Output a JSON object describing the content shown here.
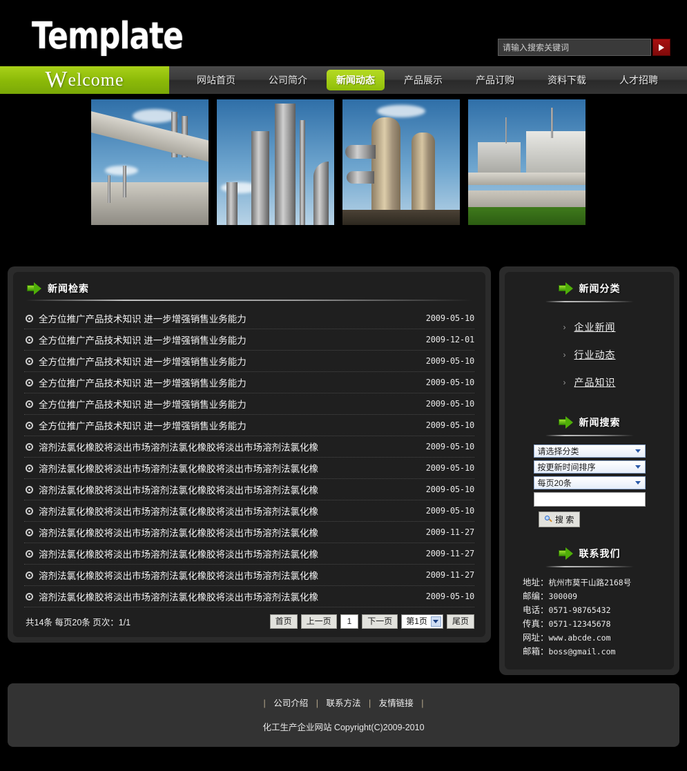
{
  "header": {
    "logo": "Template",
    "search": {
      "placeholder": "请输入搜索关键词",
      "value": "",
      "submit_icon": "play-triangle-icon"
    }
  },
  "nav": {
    "welcome_cap": "W",
    "welcome_rest": "elcome",
    "items": [
      {
        "label": "网站首页",
        "active": false
      },
      {
        "label": "公司简介",
        "active": false
      },
      {
        "label": "新闻动态",
        "active": true
      },
      {
        "label": "产品展示",
        "active": false
      },
      {
        "label": "产品订购",
        "active": false
      },
      {
        "label": "资料下载",
        "active": false
      },
      {
        "label": "人才招聘",
        "active": false
      }
    ]
  },
  "banner": {
    "images": [
      {
        "alt": "水泥厂输送廊道与烟囱"
      },
      {
        "alt": "炼油厂蒸馏塔"
      },
      {
        "alt": "化工厂管道与反应塔"
      },
      {
        "alt": "储油罐区"
      }
    ]
  },
  "news_panel": {
    "title": "新闻检索",
    "icon": "green-arrow-icon",
    "rows": [
      {
        "title": "全方位推广产品技术知识  进一步增强销售业务能力",
        "date": "2009-05-10"
      },
      {
        "title": "全方位推广产品技术知识  进一步增强销售业务能力",
        "date": "2009-12-01"
      },
      {
        "title": "全方位推广产品技术知识  进一步增强销售业务能力",
        "date": "2009-05-10"
      },
      {
        "title": "全方位推广产品技术知识  进一步增强销售业务能力",
        "date": "2009-05-10"
      },
      {
        "title": "全方位推广产品技术知识  进一步增强销售业务能力",
        "date": "2009-05-10"
      },
      {
        "title": "全方位推广产品技术知识  进一步增强销售业务能力",
        "date": "2009-05-10"
      },
      {
        "title": "溶剂法氯化橡胶将淡出市场溶剂法氯化橡胶将淡出市场溶剂法氯化橡",
        "date": "2009-05-10"
      },
      {
        "title": "溶剂法氯化橡胶将淡出市场溶剂法氯化橡胶将淡出市场溶剂法氯化橡",
        "date": "2009-05-10"
      },
      {
        "title": "溶剂法氯化橡胶将淡出市场溶剂法氯化橡胶将淡出市场溶剂法氯化橡",
        "date": "2009-05-10"
      },
      {
        "title": "溶剂法氯化橡胶将淡出市场溶剂法氯化橡胶将淡出市场溶剂法氯化橡",
        "date": "2009-05-10"
      },
      {
        "title": "溶剂法氯化橡胶将淡出市场溶剂法氯化橡胶将淡出市场溶剂法氯化橡",
        "date": "2009-11-27"
      },
      {
        "title": "溶剂法氯化橡胶将淡出市场溶剂法氯化橡胶将淡出市场溶剂法氯化橡",
        "date": "2009-11-27"
      },
      {
        "title": "溶剂法氯化橡胶将淡出市场溶剂法氯化橡胶将淡出市场溶剂法氯化橡",
        "date": "2009-11-27"
      },
      {
        "title": "溶剂法氯化橡胶将淡出市场溶剂法氯化橡胶将淡出市场溶剂法氯化橡",
        "date": "2009-05-10"
      }
    ],
    "pager": {
      "info": "共14条 每页20条 页次：1/1",
      "first": "首页",
      "prev": "上一页",
      "current": "1",
      "next": "下一页",
      "jump_value": "第1页",
      "last": "尾页"
    }
  },
  "sidebar": {
    "category": {
      "title": "新闻分类",
      "icon": "green-arrow-icon",
      "items": [
        {
          "chevron": "›",
          "label": "企业新闻"
        },
        {
          "chevron": "›",
          "label": "行业动态"
        },
        {
          "chevron": "›",
          "label": "产品知识"
        }
      ]
    },
    "search": {
      "title": "新闻搜索",
      "icon": "green-arrow-icon",
      "category_select": "请选择分类",
      "sort_select": "按更新时间排序",
      "pagesize_select": "每页20条",
      "keyword_value": "",
      "keyword_placeholder": "",
      "button_label": "搜 索",
      "button_icon": "magnifier-icon"
    },
    "contact": {
      "title": "联系我们",
      "icon": "green-arrow-icon",
      "rows": [
        {
          "label": "地址：",
          "value": "杭州市莫干山路2168号"
        },
        {
          "label": "邮编：",
          "value": "300009"
        },
        {
          "label": "电话：",
          "value": "0571-98765432"
        },
        {
          "label": "传真：",
          "value": "0571-12345678"
        },
        {
          "label": "网址：",
          "value": "www.abcde.com"
        },
        {
          "label": "邮箱：",
          "value": "boss@gmail.com"
        }
      ]
    }
  },
  "footer": {
    "sep": "|",
    "links": [
      {
        "label": "公司介绍"
      },
      {
        "label": "联系方法"
      },
      {
        "label": "友情链接"
      }
    ],
    "copyright": "化工生产企业网站 Copyright(C)2009-2010"
  },
  "colors": {
    "accent_green": "#8fbe09",
    "page_bg": "#000000",
    "panel_outer": "#2b2b2b",
    "panel_inner": "#1f1f1f",
    "footer_bg": "#333333",
    "search_red": "#a81010"
  }
}
